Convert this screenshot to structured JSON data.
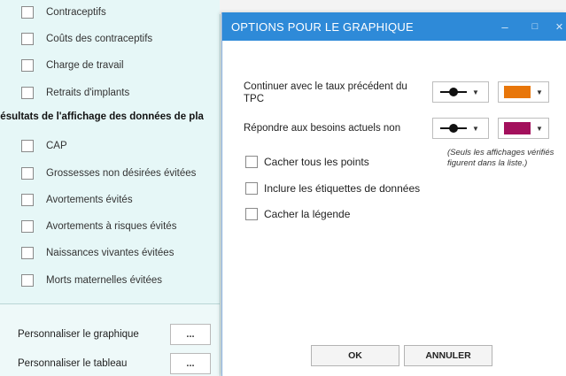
{
  "left_panel": {
    "top_items": [
      {
        "label": "Contraceptifs"
      },
      {
        "label": "Coûts des contraceptifs"
      },
      {
        "label": "Charge de travail"
      },
      {
        "label": "Retraits d'implants"
      }
    ],
    "section_title": "Résultats de l'affichage des données de pla",
    "result_items": [
      {
        "label": "CAP"
      },
      {
        "label": "Grossesses non désirées évitées"
      },
      {
        "label": "Avortements évités"
      },
      {
        "label": "Avortements à risques évités"
      },
      {
        "label": "Naissances vivantes évitées"
      },
      {
        "label": "Morts maternelles évitées"
      }
    ],
    "customize": [
      {
        "label": "Personnaliser le graphique",
        "button": "..."
      },
      {
        "label": "Personnaliser le tableau",
        "button": "..."
      }
    ]
  },
  "dialog": {
    "title": "OPTIONS POUR LE GRAPHIQUE",
    "minimize_glyph": "–",
    "maximize_glyph": "□",
    "close_glyph": "✕",
    "series": [
      {
        "label": "Continuer avec le taux précédent du TPC",
        "line_style": "line-with-marker",
        "color": "#e8760a"
      },
      {
        "label": "Répondre aux besoins actuels non",
        "line_style": "line-with-marker",
        "color": "#a3105c"
      }
    ],
    "options": [
      {
        "label": "Cacher tous les points",
        "checked": false
      },
      {
        "label": "Inclure les étiquettes de données",
        "checked": false
      },
      {
        "label": "Cacher la légende",
        "checked": false
      }
    ],
    "note": "(Seuls les affichages vérifiés figurent dans la liste.)",
    "ok_label": "OK",
    "cancel_label": "ANNULER",
    "dropdown_arrow": "▼"
  },
  "colors": {
    "title_bar": "#2e8ad8",
    "left_panel_bg": "#e6f7f7"
  }
}
